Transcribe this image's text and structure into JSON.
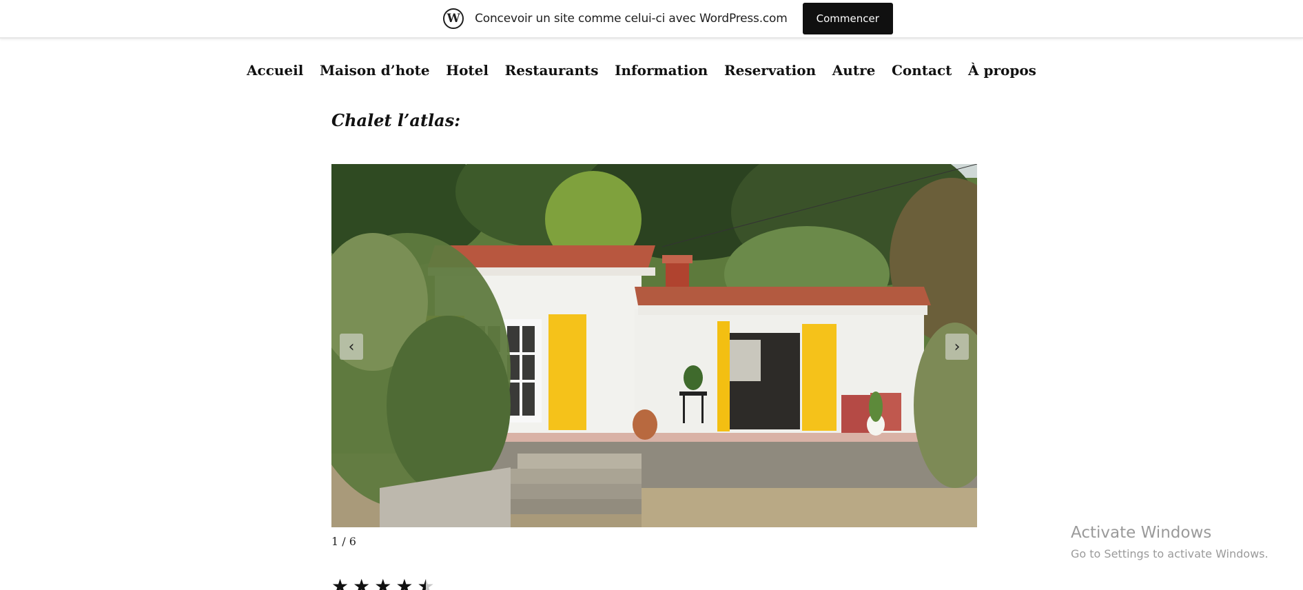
{
  "wp_banner": {
    "logo_letter": "W",
    "text": "Concevoir un site comme celui-ci avec WordPress.com",
    "button_label": "Commencer"
  },
  "nav": {
    "items": [
      {
        "label": "Accueil"
      },
      {
        "label": "Maison d’hote"
      },
      {
        "label": "Hotel"
      },
      {
        "label": "Restaurants"
      },
      {
        "label": "Information"
      },
      {
        "label": "Reservation"
      },
      {
        "label": "Autre"
      },
      {
        "label": "Contact"
      },
      {
        "label": "À propos"
      }
    ]
  },
  "page": {
    "title": "Chalet l’atlas:"
  },
  "slideshow": {
    "prev_icon": "chevron-left-icon",
    "next_icon": "chevron-right-icon",
    "prev_glyph": "‹",
    "next_glyph": "›",
    "counter": "1 / 6",
    "current_slide": 1,
    "total_slides": 6
  },
  "rating": {
    "value": 4.5,
    "max": 5,
    "star_glyph": "★"
  },
  "windows_watermark": {
    "title": "Activate Windows",
    "subtitle": "Go to Settings to activate Windows."
  }
}
